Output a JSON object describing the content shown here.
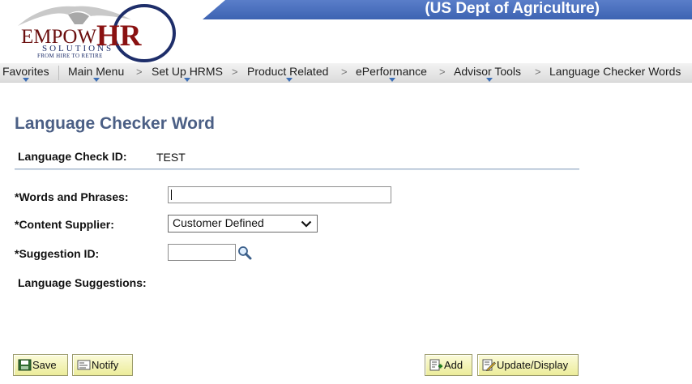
{
  "header": {
    "title": "(US Dept of Agriculture)",
    "logo": {
      "brand_main": "EMPOW",
      "brand_accent": "HR",
      "subtitle": "SOLUTIONS",
      "tagline": "FROM HIRE TO RETIRE"
    }
  },
  "nav": {
    "favorites": "Favorites",
    "main_menu": "Main Menu",
    "crumbs": [
      "Set Up HRMS",
      "Product Related",
      "ePerformance",
      "Advisor Tools",
      "Language Checker Words"
    ],
    "separator": ">"
  },
  "page": {
    "title": "Language Checker Word",
    "check_id_label": "Language Check ID:",
    "check_id_value": "TEST",
    "words_label": "*Words and Phrases:",
    "words_value": "",
    "supplier_label": "*Content Supplier:",
    "supplier_value": "Customer Defined",
    "suggestion_label": "*Suggestion ID:",
    "suggestion_value": "",
    "suggestions_label": "Language Suggestions:"
  },
  "buttons": {
    "save": "Save",
    "notify": "Notify",
    "add": "Add",
    "update": "Update/Display"
  },
  "colors": {
    "banner": "#3d63b2",
    "title": "#4b5f85",
    "button": "#ecec9a"
  }
}
